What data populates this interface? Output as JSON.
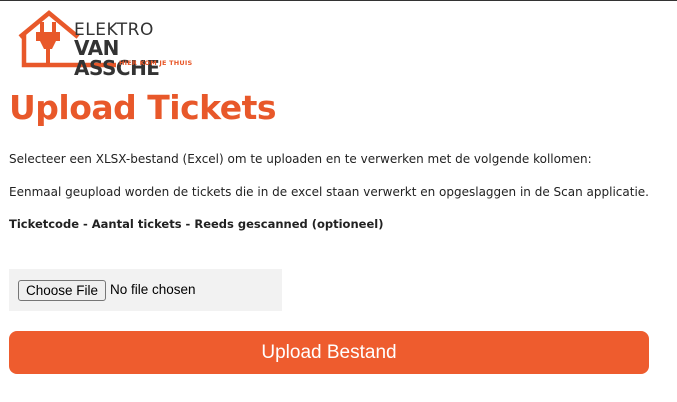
{
  "logo": {
    "line1": "ELEKTRO",
    "line2": "VAN ASSCHE",
    "tagline": "HIER KOM JE THUIS",
    "brand_color": "#e8582a",
    "icon": "house-plug-icon"
  },
  "page": {
    "title": "Upload Tickets",
    "intro": "Selecteer een XLSX-bestand (Excel) om te uploaden en te verwerken met de volgende kollomen:",
    "info": "Eenmaal geupload worden de tickets die in de excel staan verwerkt en opgeslaggen in de Scan applicatie.",
    "columns": "Ticketcode - Aantal tickets - Reeds gescanned (optioneel)"
  },
  "file_input": {
    "button_label": "Choose File",
    "status": "No file chosen"
  },
  "submit": {
    "label": "Upload Bestand",
    "color": "#ee5c2e"
  }
}
